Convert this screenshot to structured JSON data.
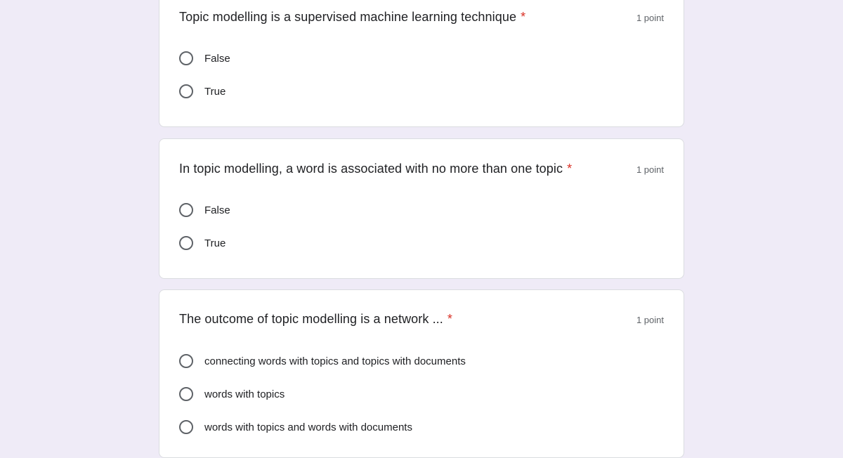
{
  "questions": [
    {
      "title": "Topic modelling is a supervised machine learning technique",
      "required_mark": "*",
      "points": "1 point",
      "options": [
        "False",
        "True"
      ]
    },
    {
      "title": "In topic modelling, a word is associated with no more than one topic",
      "required_mark": "*",
      "points": "1 point",
      "options": [
        "False",
        "True"
      ]
    },
    {
      "title": "The outcome of topic modelling is a network ...",
      "required_mark": "*",
      "points": "1 point",
      "options": [
        "connecting words with topics and topics with documents",
        "words with topics",
        "words with topics and words with documents"
      ]
    }
  ],
  "colors": {
    "background": "#efebf7",
    "card": "#ffffff",
    "required": "#d93025",
    "radio_border": "#5f6368"
  }
}
